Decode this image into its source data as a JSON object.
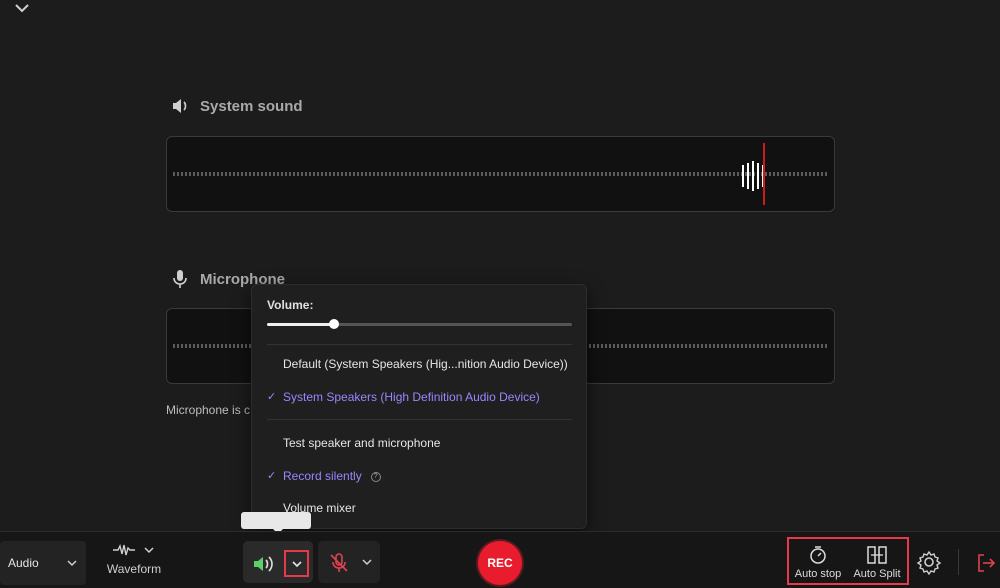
{
  "sections": {
    "system_sound": {
      "title": "System sound"
    },
    "microphone": {
      "title": "Microphone",
      "note": "Microphone is c"
    }
  },
  "menu": {
    "volume_label": "Volume:",
    "volume_level": 0.22,
    "devices": [
      {
        "label": "Default (System Speakers (Hig...nition Audio Device))",
        "selected": false
      },
      {
        "label": "System Speakers (High Definition Audio Device)",
        "selected": true
      }
    ],
    "options": [
      {
        "label": "Test speaker and microphone",
        "selected": false
      },
      {
        "label": "Record silently",
        "selected": true
      },
      {
        "label": "Volume mixer",
        "selected": false
      }
    ]
  },
  "toolbar": {
    "mode": "Audio",
    "waveform_label": "Waveform",
    "rec_label": "REC",
    "auto_stop_label": "Auto stop",
    "auto_split_label": "Auto Split"
  },
  "colors": {
    "accent": "#9a86ff",
    "rec": "#e81c2d",
    "highlight_box": "#e63a4a",
    "speaker_active": "#5fcf6a"
  },
  "icons": {
    "collapse": "chevron-down-icon",
    "system_sound": "speaker-icon",
    "microphone": "microphone-icon",
    "settings": "gear-icon",
    "exit": "exit-icon"
  }
}
